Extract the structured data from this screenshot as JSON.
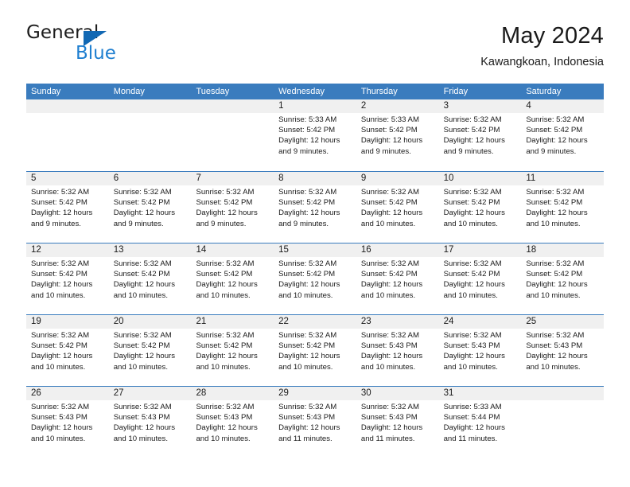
{
  "brand": {
    "name_part1": "General",
    "name_part2": "Blue",
    "flag_icon": "triangle-flag-icon",
    "accent_color": "#1268b3",
    "blue_text_color": "#1f7fd0"
  },
  "header": {
    "month_title": "May 2024",
    "location": "Kawangkoan, Indonesia"
  },
  "calendar": {
    "header_bg_color": "#3a7cbe",
    "daynum_band_color": "#f0f0f0",
    "weekdays": [
      "Sunday",
      "Monday",
      "Tuesday",
      "Wednesday",
      "Thursday",
      "Friday",
      "Saturday"
    ],
    "weeks": [
      [
        {
          "day": "",
          "sunrise": "",
          "sunset": "",
          "daylight_line1": "",
          "daylight_line2": ""
        },
        {
          "day": "",
          "sunrise": "",
          "sunset": "",
          "daylight_line1": "",
          "daylight_line2": ""
        },
        {
          "day": "",
          "sunrise": "",
          "sunset": "",
          "daylight_line1": "",
          "daylight_line2": ""
        },
        {
          "day": "1",
          "sunrise": "Sunrise: 5:33 AM",
          "sunset": "Sunset: 5:42 PM",
          "daylight_line1": "Daylight: 12 hours",
          "daylight_line2": "and 9 minutes."
        },
        {
          "day": "2",
          "sunrise": "Sunrise: 5:33 AM",
          "sunset": "Sunset: 5:42 PM",
          "daylight_line1": "Daylight: 12 hours",
          "daylight_line2": "and 9 minutes."
        },
        {
          "day": "3",
          "sunrise": "Sunrise: 5:32 AM",
          "sunset": "Sunset: 5:42 PM",
          "daylight_line1": "Daylight: 12 hours",
          "daylight_line2": "and 9 minutes."
        },
        {
          "day": "4",
          "sunrise": "Sunrise: 5:32 AM",
          "sunset": "Sunset: 5:42 PM",
          "daylight_line1": "Daylight: 12 hours",
          "daylight_line2": "and 9 minutes."
        }
      ],
      [
        {
          "day": "5",
          "sunrise": "Sunrise: 5:32 AM",
          "sunset": "Sunset: 5:42 PM",
          "daylight_line1": "Daylight: 12 hours",
          "daylight_line2": "and 9 minutes."
        },
        {
          "day": "6",
          "sunrise": "Sunrise: 5:32 AM",
          "sunset": "Sunset: 5:42 PM",
          "daylight_line1": "Daylight: 12 hours",
          "daylight_line2": "and 9 minutes."
        },
        {
          "day": "7",
          "sunrise": "Sunrise: 5:32 AM",
          "sunset": "Sunset: 5:42 PM",
          "daylight_line1": "Daylight: 12 hours",
          "daylight_line2": "and 9 minutes."
        },
        {
          "day": "8",
          "sunrise": "Sunrise: 5:32 AM",
          "sunset": "Sunset: 5:42 PM",
          "daylight_line1": "Daylight: 12 hours",
          "daylight_line2": "and 9 minutes."
        },
        {
          "day": "9",
          "sunrise": "Sunrise: 5:32 AM",
          "sunset": "Sunset: 5:42 PM",
          "daylight_line1": "Daylight: 12 hours",
          "daylight_line2": "and 10 minutes."
        },
        {
          "day": "10",
          "sunrise": "Sunrise: 5:32 AM",
          "sunset": "Sunset: 5:42 PM",
          "daylight_line1": "Daylight: 12 hours",
          "daylight_line2": "and 10 minutes."
        },
        {
          "day": "11",
          "sunrise": "Sunrise: 5:32 AM",
          "sunset": "Sunset: 5:42 PM",
          "daylight_line1": "Daylight: 12 hours",
          "daylight_line2": "and 10 minutes."
        }
      ],
      [
        {
          "day": "12",
          "sunrise": "Sunrise: 5:32 AM",
          "sunset": "Sunset: 5:42 PM",
          "daylight_line1": "Daylight: 12 hours",
          "daylight_line2": "and 10 minutes."
        },
        {
          "day": "13",
          "sunrise": "Sunrise: 5:32 AM",
          "sunset": "Sunset: 5:42 PM",
          "daylight_line1": "Daylight: 12 hours",
          "daylight_line2": "and 10 minutes."
        },
        {
          "day": "14",
          "sunrise": "Sunrise: 5:32 AM",
          "sunset": "Sunset: 5:42 PM",
          "daylight_line1": "Daylight: 12 hours",
          "daylight_line2": "and 10 minutes."
        },
        {
          "day": "15",
          "sunrise": "Sunrise: 5:32 AM",
          "sunset": "Sunset: 5:42 PM",
          "daylight_line1": "Daylight: 12 hours",
          "daylight_line2": "and 10 minutes."
        },
        {
          "day": "16",
          "sunrise": "Sunrise: 5:32 AM",
          "sunset": "Sunset: 5:42 PM",
          "daylight_line1": "Daylight: 12 hours",
          "daylight_line2": "and 10 minutes."
        },
        {
          "day": "17",
          "sunrise": "Sunrise: 5:32 AM",
          "sunset": "Sunset: 5:42 PM",
          "daylight_line1": "Daylight: 12 hours",
          "daylight_line2": "and 10 minutes."
        },
        {
          "day": "18",
          "sunrise": "Sunrise: 5:32 AM",
          "sunset": "Sunset: 5:42 PM",
          "daylight_line1": "Daylight: 12 hours",
          "daylight_line2": "and 10 minutes."
        }
      ],
      [
        {
          "day": "19",
          "sunrise": "Sunrise: 5:32 AM",
          "sunset": "Sunset: 5:42 PM",
          "daylight_line1": "Daylight: 12 hours",
          "daylight_line2": "and 10 minutes."
        },
        {
          "day": "20",
          "sunrise": "Sunrise: 5:32 AM",
          "sunset": "Sunset: 5:42 PM",
          "daylight_line1": "Daylight: 12 hours",
          "daylight_line2": "and 10 minutes."
        },
        {
          "day": "21",
          "sunrise": "Sunrise: 5:32 AM",
          "sunset": "Sunset: 5:42 PM",
          "daylight_line1": "Daylight: 12 hours",
          "daylight_line2": "and 10 minutes."
        },
        {
          "day": "22",
          "sunrise": "Sunrise: 5:32 AM",
          "sunset": "Sunset: 5:42 PM",
          "daylight_line1": "Daylight: 12 hours",
          "daylight_line2": "and 10 minutes."
        },
        {
          "day": "23",
          "sunrise": "Sunrise: 5:32 AM",
          "sunset": "Sunset: 5:43 PM",
          "daylight_line1": "Daylight: 12 hours",
          "daylight_line2": "and 10 minutes."
        },
        {
          "day": "24",
          "sunrise": "Sunrise: 5:32 AM",
          "sunset": "Sunset: 5:43 PM",
          "daylight_line1": "Daylight: 12 hours",
          "daylight_line2": "and 10 minutes."
        },
        {
          "day": "25",
          "sunrise": "Sunrise: 5:32 AM",
          "sunset": "Sunset: 5:43 PM",
          "daylight_line1": "Daylight: 12 hours",
          "daylight_line2": "and 10 minutes."
        }
      ],
      [
        {
          "day": "26",
          "sunrise": "Sunrise: 5:32 AM",
          "sunset": "Sunset: 5:43 PM",
          "daylight_line1": "Daylight: 12 hours",
          "daylight_line2": "and 10 minutes."
        },
        {
          "day": "27",
          "sunrise": "Sunrise: 5:32 AM",
          "sunset": "Sunset: 5:43 PM",
          "daylight_line1": "Daylight: 12 hours",
          "daylight_line2": "and 10 minutes."
        },
        {
          "day": "28",
          "sunrise": "Sunrise: 5:32 AM",
          "sunset": "Sunset: 5:43 PM",
          "daylight_line1": "Daylight: 12 hours",
          "daylight_line2": "and 10 minutes."
        },
        {
          "day": "29",
          "sunrise": "Sunrise: 5:32 AM",
          "sunset": "Sunset: 5:43 PM",
          "daylight_line1": "Daylight: 12 hours",
          "daylight_line2": "and 11 minutes."
        },
        {
          "day": "30",
          "sunrise": "Sunrise: 5:32 AM",
          "sunset": "Sunset: 5:43 PM",
          "daylight_line1": "Daylight: 12 hours",
          "daylight_line2": "and 11 minutes."
        },
        {
          "day": "31",
          "sunrise": "Sunrise: 5:33 AM",
          "sunset": "Sunset: 5:44 PM",
          "daylight_line1": "Daylight: 12 hours",
          "daylight_line2": "and 11 minutes."
        },
        {
          "day": "",
          "sunrise": "",
          "sunset": "",
          "daylight_line1": "",
          "daylight_line2": ""
        }
      ]
    ]
  }
}
